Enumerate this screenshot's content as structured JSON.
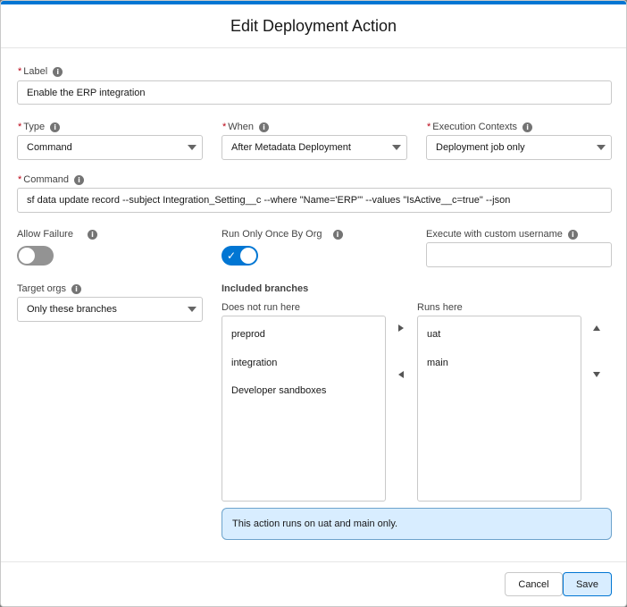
{
  "modal": {
    "title": "Edit Deployment Action"
  },
  "fields": {
    "label": {
      "label": "Label",
      "required": "*",
      "value": "Enable the ERP integration"
    },
    "type": {
      "label": "Type",
      "required": "*",
      "value": "Command"
    },
    "when": {
      "label": "When",
      "required": "*",
      "value": "After Metadata Deployment"
    },
    "execution_contexts": {
      "label": "Execution Contexts",
      "required": "*",
      "value": "Deployment job only"
    },
    "command": {
      "label": "Command",
      "required": "*",
      "value": "sf data update record --subject Integration_Setting__c --where \"Name='ERP'\" --values \"IsActive__c=true\" --json"
    },
    "allow_failure": {
      "label": "Allow Failure",
      "checked": false
    },
    "run_only_once": {
      "label": "Run Only Once By Org",
      "checked": true,
      "check_glyph": "✓"
    },
    "custom_username": {
      "label": "Execute with custom username",
      "value": ""
    },
    "target_orgs": {
      "label": "Target orgs",
      "value": "Only these branches"
    }
  },
  "branches": {
    "section_label": "Included branches",
    "available_label": "Does not run here",
    "selected_label": "Runs here",
    "available": [
      "preprod",
      "integration",
      "Developer sandboxes"
    ],
    "selected": [
      "uat",
      "main"
    ],
    "notice": "This action runs on uat and main only."
  },
  "footer": {
    "cancel": "Cancel",
    "save": "Save"
  },
  "icons": {
    "info": "i"
  },
  "colors": {
    "brand": "#0176d3",
    "required": "#ba0517",
    "notice_bg": "#d8edff"
  }
}
